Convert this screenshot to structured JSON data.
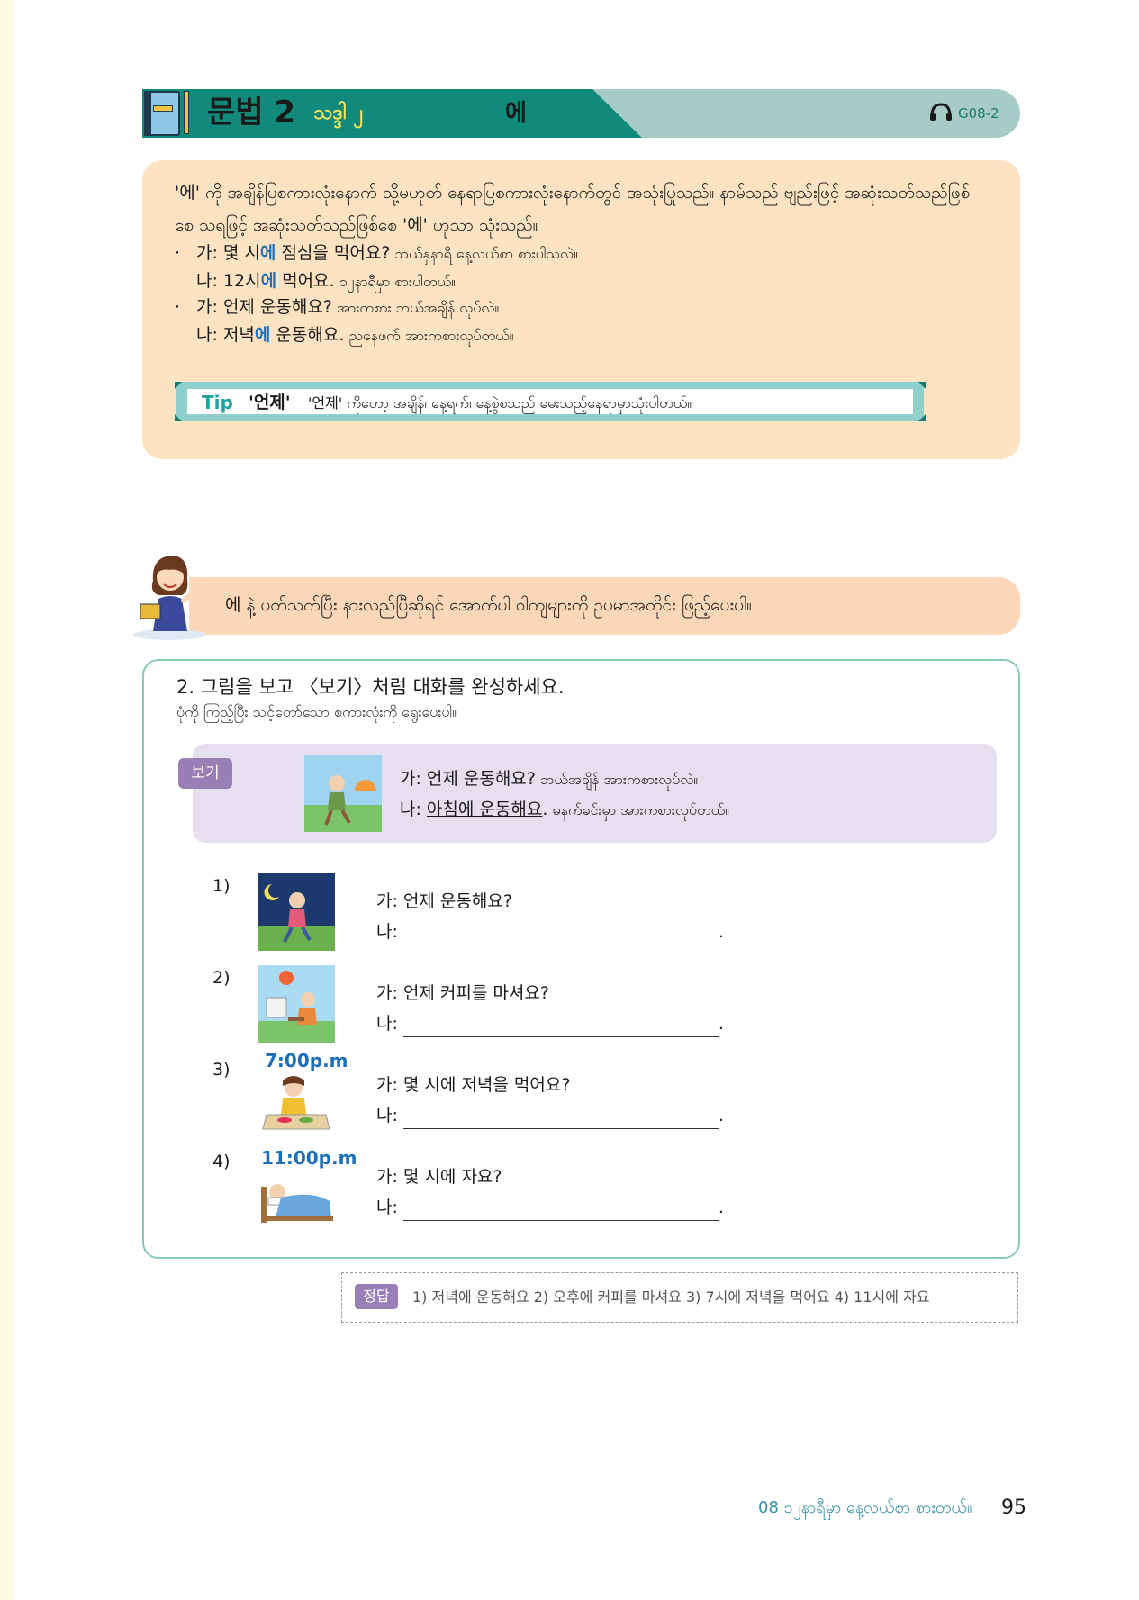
{
  "header": {
    "title": "문법 2",
    "subtitle": "သဒ္ဒါ ၂",
    "particle": "에",
    "track_code": "G08-2"
  },
  "explanation": {
    "text": "'에' ကို အချိန်ပြစကားလုံးနောက် သို့မဟုတ် နေရာပြစကားလုံးနောက်တွင် အသုံးပြုသည်။ နာမ်သည် ဗျည်းဖြင့် အဆုံးသတ်သည်ဖြစ်စေ သရဖြင့် အဆုံးသတ်သည်ဖြစ်စေ '에' ဟုသာ သုံးသည်။",
    "examples": [
      {
        "a_pre": "가: 몇 시",
        "a_hl": "에",
        "a_post": " 점심을 먹어요?",
        "a_my": " ဘယ်နှနာရီ နေ့လယ်စာ စားပါသလဲ။",
        "b_pre": "나: 12시",
        "b_hl": "에",
        "b_post": " 먹어요.",
        "b_my": " ၁၂နာရီမှာ စားပါတယ်။"
      },
      {
        "a_pre": "가: 언제 운동해요?",
        "a_hl": "",
        "a_post": "",
        "a_my": " အားကစား ဘယ်အချိန် လုပ်လဲ။",
        "b_pre": "나: 저녁",
        "b_hl": "에",
        "b_post": " 운동해요.",
        "b_my": " ညနေဖက် အားကစားလုပ်တယ်။"
      }
    ],
    "tip": {
      "label": "Tip",
      "word": "'언제'",
      "text": "'언제' ကိုတော့ အချိန်၊ နေ့ရက်၊ နေ့စွဲစသည် မေးသည့်နေရာမှာသုံးပါတယ်။"
    }
  },
  "instruction": "에  နဲ့ ပတ်သက်ပြီး နားလည်ပြီဆိုရင် အောက်ပါ ဝါကျများကို ဥပမာအတိုင်း ဖြည့်ပေးပါ။",
  "exercise": {
    "title": "2. 그림을 보고 〈보기〉처럼 대화를 완성하세요.",
    "subtitle": "ပုံကို ကြည့်ပြီး သင့်တော်သော စကားလုံးကို ရွေးပေးပါ။",
    "sample": {
      "tag": "보기",
      "line1_ko": "가: 언제 운동해요?",
      "line1_my": " ဘယ်အချိန် အားကစားလုပ်လဲ။",
      "line2_prefix": "나: ",
      "line2_answer": "아침에 운동해요",
      "line2_dot": ".",
      "line2_my": " မနက်ခင်းမှာ အားကစားလုပ်တယ်။"
    },
    "questions": [
      {
        "num": "1)",
        "question": "가: 언제 운동해요?",
        "answer_prefix": "나:",
        "time": ""
      },
      {
        "num": "2)",
        "question": "가: 언제 커피를 마셔요?",
        "answer_prefix": "나:",
        "time": ""
      },
      {
        "num": "3)",
        "question": "가: 몇 시에 저녁을 먹어요?",
        "answer_prefix": "나:",
        "time": "7:00p.m"
      },
      {
        "num": "4)",
        "question": "가: 몇 시에 자요?",
        "answer_prefix": "나:",
        "time": "11:00p.m"
      }
    ]
  },
  "answer_key": {
    "tag": "정답",
    "text": "1) 저녁에 운동해요  2) 오후에 커피를 마셔요  3) 7시에 저녁을 먹어요  4) 11시에 자요"
  },
  "footer": {
    "chapter": "08 ၁၂နာရီမှာ နေ့လယ်စာ စားတယ်။",
    "page": "95"
  }
}
